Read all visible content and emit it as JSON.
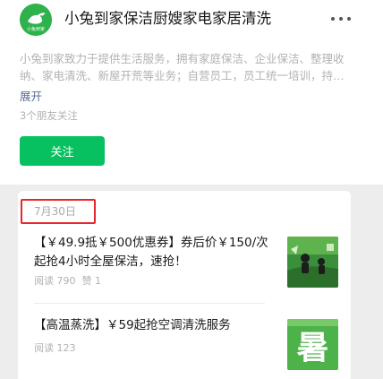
{
  "account": {
    "name": "小兔到家保洁厨嫂家电家居清洗",
    "avatar_text": "小兔到家",
    "description": "小兔到家致力于提供生活服务，拥有家庭保洁、企业保洁、整理收纳、家电清洗、新屋开荒等业务；自营员工，员工统一培训，持证上岗",
    "expand_label": "展开",
    "friends_following": "3个朋友关注",
    "follow_label": "关注",
    "more_icon": "more-dots-icon"
  },
  "colors": {
    "accent_green": "#07c160",
    "highlight_red": "#e8262b",
    "link_blue": "#576b95"
  },
  "articles_group": {
    "date": "7月30日",
    "articles": [
      {
        "title": "【￥49.9抵￥500优惠券】券后价￥150/次起抢4小时全屋保洁，速抢！",
        "reads": "阅读 790",
        "likes": "赞 1",
        "thumbnail": "cleaning-promo-thumbnail"
      },
      {
        "title": "【高温蒸洗】￥59起抢空调清洗服务",
        "reads": "阅读 123",
        "thumbnail_text": "暑",
        "thumbnail": "summer-thumbnail"
      }
    ]
  }
}
